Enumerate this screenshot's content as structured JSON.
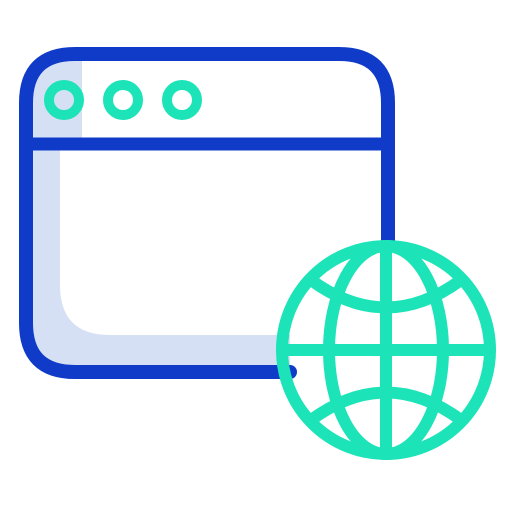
{
  "icon": {
    "name": "web-browser-globe-icon",
    "parts": {
      "window": "browser-window-icon",
      "dots": "window-control-dots-icon",
      "globe": "globe-icon"
    }
  },
  "colors": {
    "outline": "#0f3bc8",
    "accent": "#1de4b8",
    "fill": "#d6e0f5",
    "background": "#ffffff"
  }
}
